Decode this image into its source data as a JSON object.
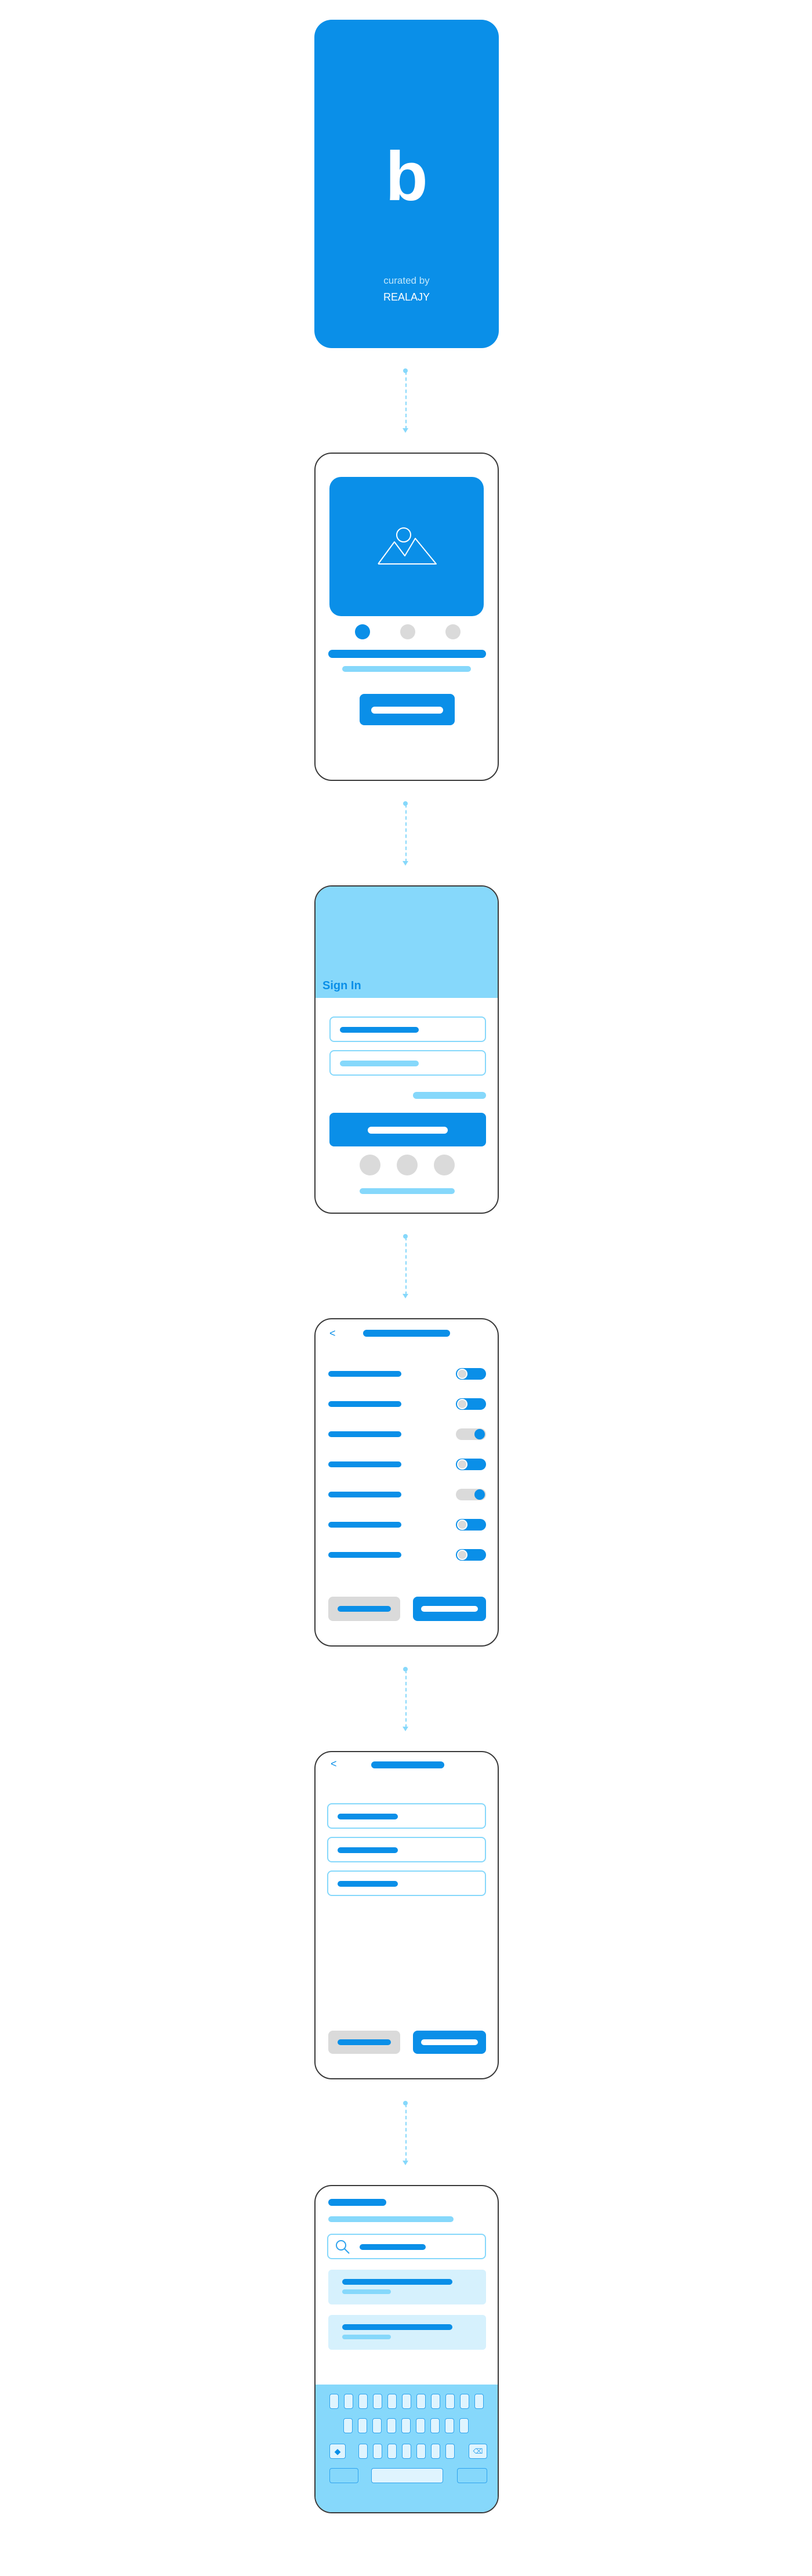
{
  "splash": {
    "logo_letter": "b",
    "curated_by": "curated by",
    "author": "REALAJY",
    "bg_color": "#0a8fe8"
  },
  "onboarding": {
    "image_icon": "mountain-image-icon",
    "active_dot_index": 0,
    "dot_count": 3
  },
  "signin": {
    "title": "Sign In",
    "header_color": "#86d8fb"
  },
  "settings": {
    "back_icon": "<",
    "toggles": [
      {
        "knob": "left"
      },
      {
        "knob": "left"
      },
      {
        "knob": "right"
      },
      {
        "knob": "left"
      },
      {
        "knob": "right"
      },
      {
        "knob": "left"
      },
      {
        "knob": "left"
      }
    ]
  },
  "form": {
    "back_icon": "<",
    "field_count": 3
  },
  "search": {
    "search_icon": "magnifier-icon",
    "result_count": 2
  },
  "colors": {
    "primary": "#0a8fe8",
    "light": "#86d8fb",
    "gray": "#dadada",
    "outline": "#3a3a3a"
  }
}
